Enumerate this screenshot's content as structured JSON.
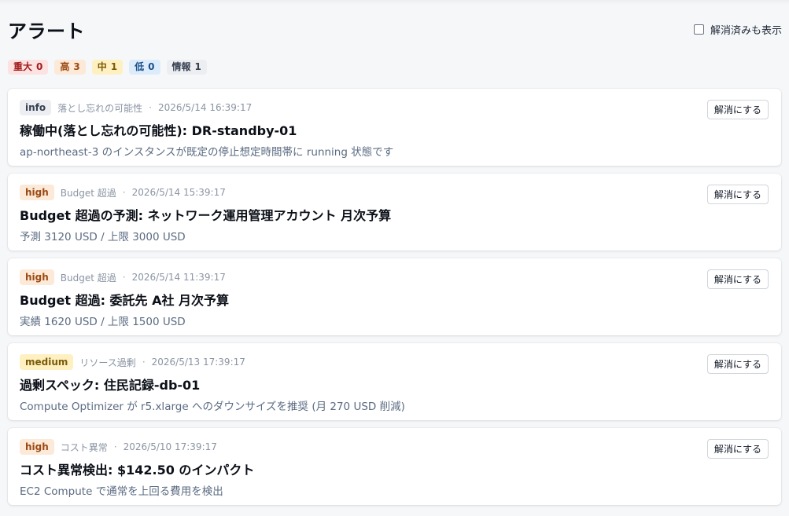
{
  "header": {
    "title": "アラート",
    "show_resolved_label": "解消済みも表示"
  },
  "severity_counts": [
    {
      "label": "重大",
      "count": "0",
      "bg": "#fde2e2",
      "fg": "#a11d1d"
    },
    {
      "label": "高",
      "count": "3",
      "bg": "#fde9d8",
      "fg": "#9a4a14"
    },
    {
      "label": "中",
      "count": "1",
      "bg": "#fff0c2",
      "fg": "#7a5a06"
    },
    {
      "label": "低",
      "count": "0",
      "bg": "#dcecfb",
      "fg": "#1d4f8a"
    },
    {
      "label": "情報",
      "count": "1",
      "bg": "#eceef2",
      "fg": "#374151"
    }
  ],
  "alerts": [
    {
      "severity": "info",
      "category": "落とし忘れの可能性",
      "timestamp": "2026/5/14 16:39:17",
      "title": "稼働中(落とし忘れの可能性): DR-standby-01",
      "description": "ap-northeast-3 のインスタンスが既定の停止想定時間帯に running 状態です",
      "action_label": "解消にする"
    },
    {
      "severity": "high",
      "category": "Budget 超過",
      "timestamp": "2026/5/14 15:39:17",
      "title": "Budget 超過の予測: ネットワーク運用管理アカウント 月次予算",
      "description": "予測 3120 USD / 上限 3000 USD",
      "action_label": "解消にする"
    },
    {
      "severity": "high",
      "category": "Budget 超過",
      "timestamp": "2026/5/14 11:39:17",
      "title": "Budget 超過: 委託先 A社 月次予算",
      "description": "実績 1620 USD / 上限 1500 USD",
      "action_label": "解消にする"
    },
    {
      "severity": "medium",
      "category": "リソース過剰",
      "timestamp": "2026/5/13 17:39:17",
      "title": "過剰スペック: 住民記録-db-01",
      "description": "Compute Optimizer が r5.xlarge へのダウンサイズを推奨 (月 270 USD 削減)",
      "action_label": "解消にする"
    },
    {
      "severity": "high",
      "category": "コスト異常",
      "timestamp": "2026/5/10 17:39:17",
      "title": "コスト異常検出: $142.50 のインパクト",
      "description": "EC2 Compute で通常を上回る費用を検出",
      "action_label": "解消にする"
    }
  ]
}
